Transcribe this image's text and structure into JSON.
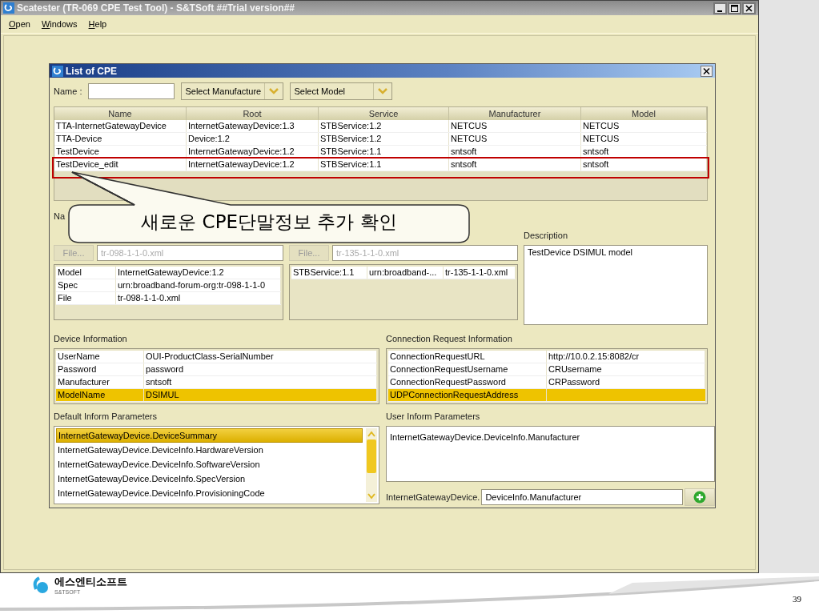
{
  "window": {
    "title": "Scatester (TR-069 CPE Test Tool) - S&TSoft ##Trial version##"
  },
  "menu": [
    {
      "label": "Open"
    },
    {
      "label": "Windows"
    },
    {
      "label": "Help"
    }
  ],
  "dialog": {
    "title": "List of CPE",
    "filter": {
      "name_label": "Name :",
      "manufacturer": "Select Manufacture",
      "model": "Select Model"
    },
    "table": {
      "columns": [
        "Name",
        "Root",
        "Service",
        "Manufacturer",
        "Model"
      ],
      "rows": [
        {
          "cells": [
            "TTA-InternetGatewayDevice",
            "InternetGatewayDevice:1.3",
            "STBService:1.2",
            "NETCUS",
            "NETCUS"
          ],
          "marked": false
        },
        {
          "cells": [
            "TTA-Device",
            "Device:1.2",
            "STBService:1.2",
            "NETCUS",
            "NETCUS"
          ],
          "marked": false
        },
        {
          "cells": [
            "TestDevice",
            "InternetGatewayDevice:1.2",
            "STBService:1.1",
            "sntsoft",
            "sntsoft"
          ],
          "marked": false
        },
        {
          "cells": [
            "TestDevice_edit",
            "InternetGatewayDevice:1.2",
            "STBService:1.1",
            "sntsoft",
            "sntsoft"
          ],
          "marked": true
        }
      ]
    },
    "name_label": "Na",
    "root_model": {
      "file_button": "File...",
      "file": "tr-098-1-1-0.xml",
      "disabled": true,
      "rows": [
        [
          "Model",
          "InternetGatewayDevice:1.2"
        ],
        [
          "Spec",
          "urn:broadband-forum-org:tr-098-1-1-0"
        ],
        [
          "File",
          "tr-098-1-1-0.xml"
        ]
      ]
    },
    "service_model": {
      "file_button": "File...",
      "file": "tr-135-1-1-0.xml",
      "disabled": true,
      "rows": [
        [
          "STBService:1.1",
          "urn:broadband-...",
          "tr-135-1-1-0.xml"
        ]
      ]
    },
    "description": {
      "label": "Description",
      "text": "TestDevice DSIMUL model"
    },
    "device_info": {
      "label": "Device Information",
      "rows": [
        {
          "cells": [
            "UserName",
            "OUI-ProductClass-SerialNumber"
          ],
          "selected": false
        },
        {
          "cells": [
            "Password",
            "password"
          ],
          "selected": false
        },
        {
          "cells": [
            "Manufacturer",
            "sntsoft"
          ],
          "selected": false
        },
        {
          "cells": [
            "ModelName",
            "DSIMUL"
          ],
          "selected": true
        }
      ]
    },
    "connection_request": {
      "label": "Connection Request Information",
      "rows": [
        {
          "cells": [
            "ConnectionRequestURL",
            "http://10.0.2.15:8082/cr"
          ],
          "selected": false
        },
        {
          "cells": [
            "ConnectionRequestUsername",
            "CRUsername"
          ],
          "selected": false
        },
        {
          "cells": [
            "ConnectionRequestPassword",
            "CRPassword"
          ],
          "selected": false
        },
        {
          "cells": [
            "UDPConnectionRequestAddress"
          ],
          "selected": true
        }
      ]
    },
    "default_inform": {
      "label": "Default Inform Parameters",
      "items": [
        {
          "text": "InternetGatewayDevice.DeviceSummary",
          "selected": true
        },
        {
          "text": "InternetGatewayDevice.DeviceInfo.HardwareVersion",
          "selected": false
        },
        {
          "text": "InternetGatewayDevice.DeviceInfo.SoftwareVersion",
          "selected": false
        },
        {
          "text": "InternetGatewayDevice.DeviceInfo.SpecVersion",
          "selected": false
        },
        {
          "text": "InternetGatewayDevice.DeviceInfo.ProvisioningCode",
          "selected": false
        }
      ]
    },
    "user_inform": {
      "label": "User Inform Parameters",
      "items": [
        "InternetGatewayDevice.DeviceInfo.Manufacturer"
      ],
      "prefix": "InternetGatewayDevice.",
      "input": "DeviceInfo.Manufacturer"
    }
  },
  "callout": {
    "text": "새로운 CPE단말정보 추가 확인"
  },
  "footer": {
    "company": "에스엔티소프트",
    "company_en": "S&TSOFT",
    "page": "39"
  }
}
